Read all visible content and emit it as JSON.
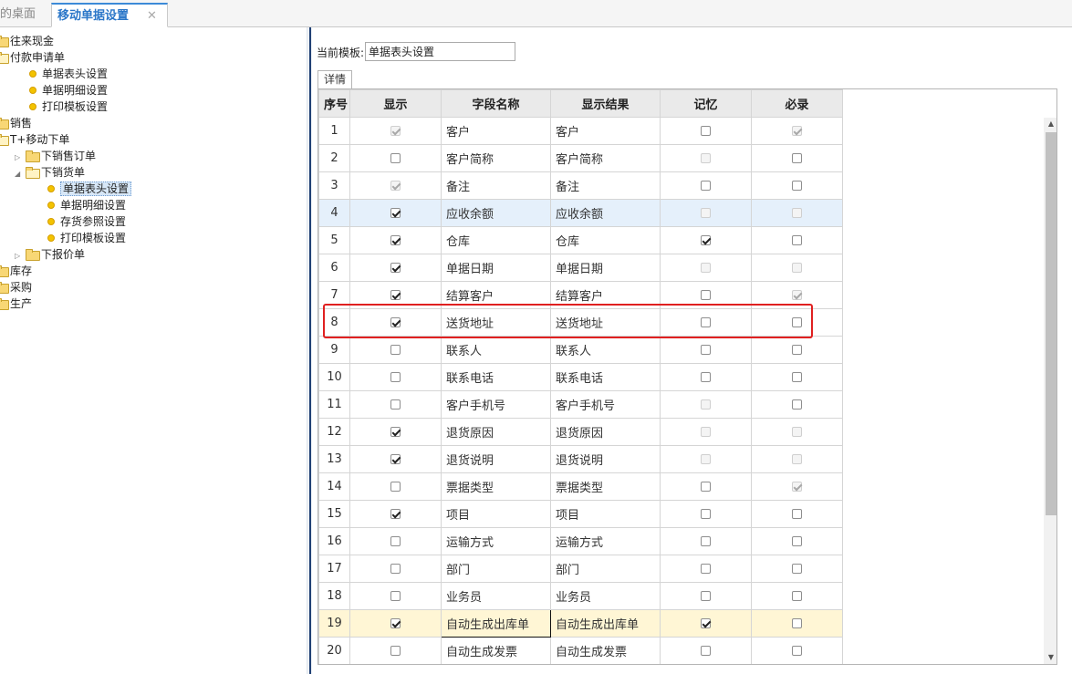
{
  "tabs": {
    "desktop_label": "的桌面",
    "active_label": "移动单据设置",
    "close_glyph": "✕"
  },
  "tree": [
    {
      "label": "往来现金",
      "kind": "folder",
      "open": false,
      "arrow": ""
    },
    {
      "label": "付款申请单",
      "kind": "folder",
      "open": true,
      "arrow": ""
    },
    {
      "label": "单据表头设置",
      "kind": "leaf"
    },
    {
      "label": "单据明细设置",
      "kind": "leaf"
    },
    {
      "label": "打印模板设置",
      "kind": "leaf"
    },
    {
      "label": "销售",
      "kind": "folder",
      "open": false,
      "arrow": ""
    },
    {
      "label": "T+移动下单",
      "kind": "folder",
      "open": true,
      "arrow": ""
    },
    {
      "label": "下销售订单",
      "kind": "folder",
      "open": false,
      "arrow": "▷"
    },
    {
      "label": "下销货单",
      "kind": "folder",
      "open": true,
      "arrow": "◢"
    },
    {
      "label": "单据表头设置",
      "kind": "leaf",
      "selected": true
    },
    {
      "label": "单据明细设置",
      "kind": "leaf"
    },
    {
      "label": "存货参照设置",
      "kind": "leaf"
    },
    {
      "label": "打印模板设置",
      "kind": "leaf"
    },
    {
      "label": "下报价单",
      "kind": "folder",
      "open": false,
      "arrow": "▷"
    },
    {
      "label": "库存",
      "kind": "folder",
      "open": false,
      "arrow": ""
    },
    {
      "label": "采购",
      "kind": "folder",
      "open": false,
      "arrow": ""
    },
    {
      "label": "生产",
      "kind": "folder",
      "open": false,
      "arrow": ""
    }
  ],
  "template": {
    "label": "当前模板:",
    "value": "单据表头设置"
  },
  "detail_tab": "详情",
  "grid": {
    "headers": [
      "序号",
      "显示",
      "字段名称",
      "显示结果",
      "记忆",
      "必录"
    ],
    "rows": [
      {
        "idx": "1",
        "show": "checked-disabled",
        "field": "客户",
        "result": "客户",
        "memory": "unchecked",
        "required": "checked-disabled"
      },
      {
        "idx": "2",
        "show": "unchecked",
        "field": "客户简称",
        "result": "客户简称",
        "memory": "disabled",
        "required": "unchecked"
      },
      {
        "idx": "3",
        "show": "checked-disabled",
        "field": "备注",
        "result": "备注",
        "memory": "unchecked",
        "required": "unchecked"
      },
      {
        "idx": "4",
        "show": "checked",
        "field": "应收余额",
        "result": "应收余额",
        "memory": "disabled",
        "required": "disabled",
        "highlight": "blue"
      },
      {
        "idx": "5",
        "show": "checked",
        "field": "仓库",
        "result": "仓库",
        "memory": "checked",
        "required": "unchecked"
      },
      {
        "idx": "6",
        "show": "checked",
        "field": "单据日期",
        "result": "单据日期",
        "memory": "disabled",
        "required": "disabled"
      },
      {
        "idx": "7",
        "show": "checked",
        "field": "结算客户",
        "result": "结算客户",
        "memory": "unchecked",
        "required": "checked-disabled"
      },
      {
        "idx": "8",
        "show": "checked",
        "field": "送货地址",
        "result": "送货地址",
        "memory": "unchecked",
        "required": "unchecked"
      },
      {
        "idx": "9",
        "show": "unchecked",
        "field": "联系人",
        "result": "联系人",
        "memory": "unchecked",
        "required": "unchecked"
      },
      {
        "idx": "10",
        "show": "unchecked",
        "field": "联系电话",
        "result": "联系电话",
        "memory": "unchecked",
        "required": "unchecked"
      },
      {
        "idx": "11",
        "show": "unchecked",
        "field": "客户手机号",
        "result": "客户手机号",
        "memory": "disabled",
        "required": "unchecked"
      },
      {
        "idx": "12",
        "show": "checked",
        "field": "退货原因",
        "result": "退货原因",
        "memory": "disabled",
        "required": "disabled"
      },
      {
        "idx": "13",
        "show": "checked",
        "field": "退货说明",
        "result": "退货说明",
        "memory": "disabled",
        "required": "disabled"
      },
      {
        "idx": "14",
        "show": "unchecked",
        "field": "票据类型",
        "result": "票据类型",
        "memory": "unchecked",
        "required": "checked-disabled"
      },
      {
        "idx": "15",
        "show": "checked",
        "field": "项目",
        "result": "项目",
        "memory": "unchecked",
        "required": "unchecked"
      },
      {
        "idx": "16",
        "show": "unchecked",
        "field": "运输方式",
        "result": "运输方式",
        "memory": "unchecked",
        "required": "unchecked"
      },
      {
        "idx": "17",
        "show": "unchecked",
        "field": "部门",
        "result": "部门",
        "memory": "unchecked",
        "required": "unchecked"
      },
      {
        "idx": "18",
        "show": "unchecked",
        "field": "业务员",
        "result": "业务员",
        "memory": "unchecked",
        "required": "unchecked"
      },
      {
        "idx": "19",
        "show": "checked",
        "field": "自动生成出库单",
        "result": "自动生成出库单",
        "memory": "checked",
        "required": "unchecked",
        "highlight": "yellow",
        "focused": true
      },
      {
        "idx": "20",
        "show": "unchecked",
        "field": "自动生成发票",
        "result": "自动生成发票",
        "memory": "unchecked",
        "required": "unchecked"
      }
    ]
  },
  "scrollbar": {
    "up_glyph": "▲",
    "down_glyph": "▼"
  },
  "colors": {
    "accent": "#2a76c8",
    "annotation": "#e02020",
    "row_highlight_blue": "#e5f0fb",
    "row_highlight_yellow": "#fff6d5"
  }
}
